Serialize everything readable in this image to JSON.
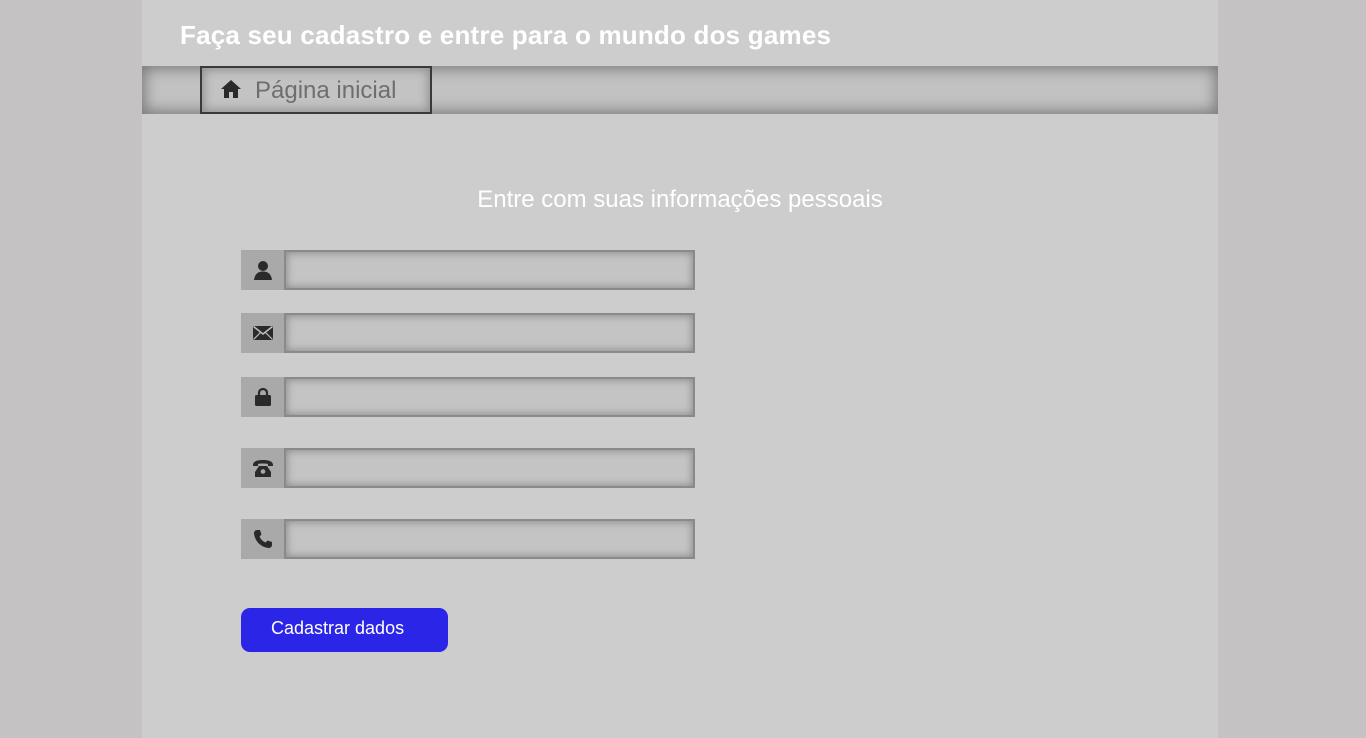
{
  "header": {
    "title": "Faça seu cadastro e entre para o mundo dos games"
  },
  "nav": {
    "home_label": "Página inicial",
    "home_icon": "home-icon"
  },
  "form": {
    "heading": "Entre com suas informações pessoais",
    "fields": [
      {
        "name": "name",
        "icon": "user-icon",
        "value": "",
        "placeholder": ""
      },
      {
        "name": "email",
        "icon": "envelope-icon",
        "value": "",
        "placeholder": ""
      },
      {
        "name": "password",
        "icon": "lock-icon",
        "value": "",
        "placeholder": ""
      },
      {
        "name": "phone",
        "icon": "telephone-icon",
        "value": "",
        "placeholder": ""
      },
      {
        "name": "mobile",
        "icon": "phone-handset-icon",
        "value": "",
        "placeholder": ""
      }
    ],
    "submit_label": "Cadastrar dados",
    "submit_color": "#2b25e8"
  }
}
